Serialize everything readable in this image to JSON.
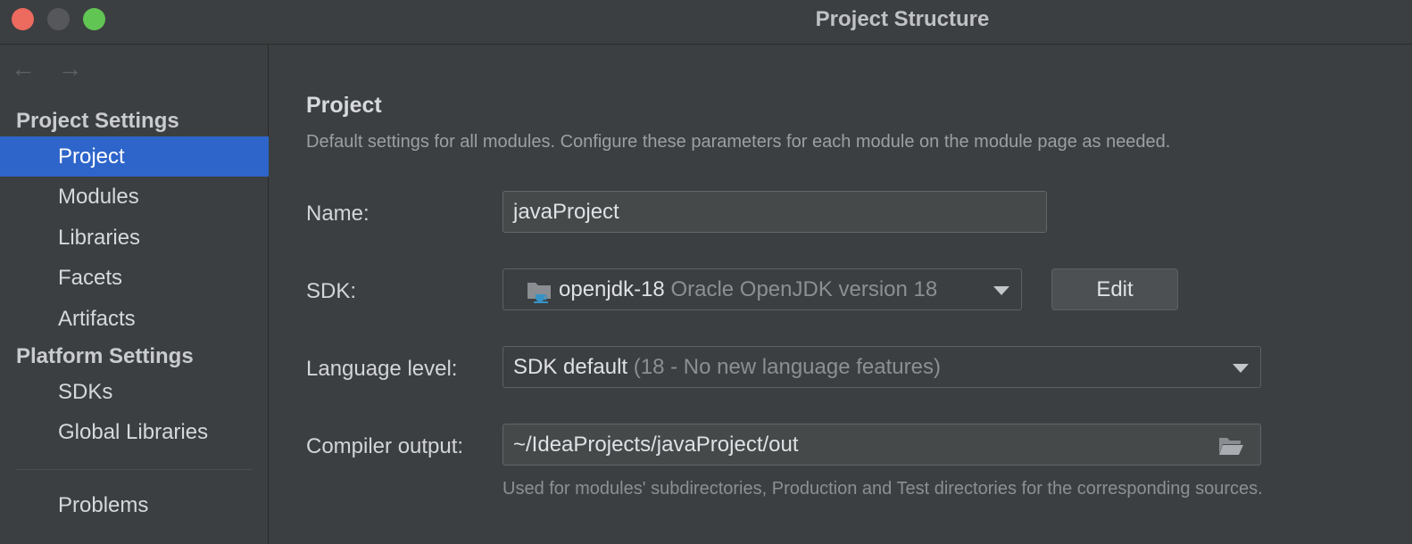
{
  "window": {
    "title": "Project Structure",
    "controls": [
      "close",
      "minimize",
      "maximize"
    ]
  },
  "sidebar": {
    "nav": {
      "back_icon": "←",
      "forward_icon": "→"
    },
    "project_settings_title": "Project Settings",
    "project_items": [
      {
        "label": "Project",
        "selected": true
      },
      {
        "label": "Modules"
      },
      {
        "label": "Libraries"
      },
      {
        "label": "Facets"
      },
      {
        "label": "Artifacts"
      }
    ],
    "platform_settings_title": "Platform Settings",
    "platform_items": [
      {
        "label": "SDKs"
      },
      {
        "label": "Global Libraries"
      }
    ],
    "problems_label": "Problems"
  },
  "main": {
    "title": "Project",
    "description": "Default settings for all modules. Configure these parameters for each module on the module page as needed.",
    "name": {
      "label": "Name:",
      "value": "javaProject"
    },
    "sdk": {
      "label": "SDK:",
      "value": "openjdk-18",
      "detail": "Oracle OpenJDK version 18",
      "icon": "jdk-folder-icon",
      "edit_label": "Edit"
    },
    "language_level": {
      "label": "Language level:",
      "value": "SDK default",
      "detail": "(18 - No new language features)"
    },
    "compiler_output": {
      "label": "Compiler output:",
      "value": "~/IdeaProjects/javaProject/out",
      "icon": "folder-open-icon",
      "hint": "Used for modules' subdirectories, Production and Test directories for the corresponding sources."
    }
  },
  "colors": {
    "background": "#3c3f41",
    "selection": "#2e65ca",
    "close": "#ec6a5e",
    "maximize": "#61c554"
  }
}
